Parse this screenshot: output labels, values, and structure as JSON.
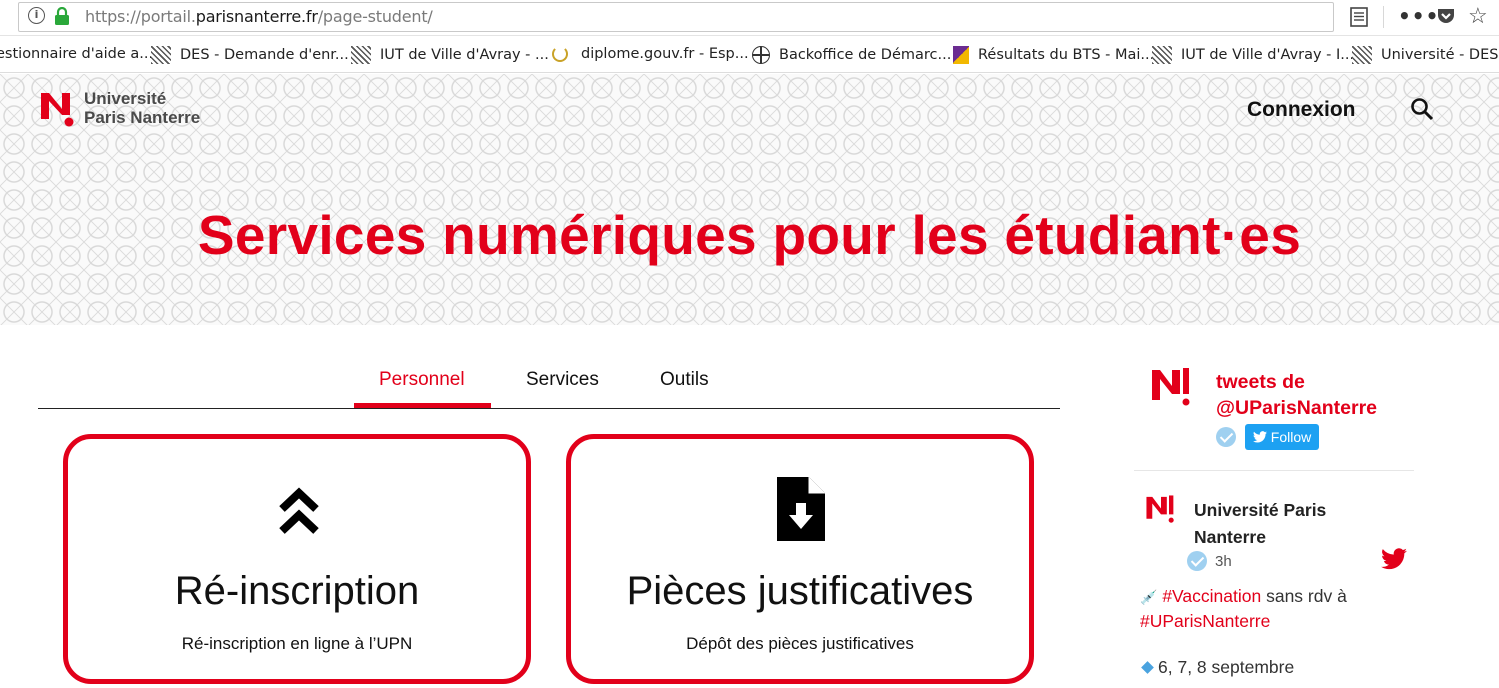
{
  "browser": {
    "url_prefix": "https://portail.",
    "url_domain": "parisnanterre.fr",
    "url_path": "/page-student/",
    "bookmarks": [
      {
        "label": "estionnaire d'aide a...",
        "icon": "none"
      },
      {
        "label": "DES - Demande d'enr...",
        "icon": "hatched-favicon-icon"
      },
      {
        "label": "IUT de Ville d'Avray - ...",
        "icon": "hatched-favicon-icon"
      },
      {
        "label": "diplome.gouv.fr - Esp...",
        "icon": "laurel-favicon-icon"
      },
      {
        "label": "Backoffice de Démarc...",
        "icon": "globe-icon"
      },
      {
        "label": "Résultats du BTS - Mai...",
        "icon": "purple-favicon-icon"
      },
      {
        "label": "IUT de Ville d'Avray - I...",
        "icon": "hatched-favicon-icon"
      },
      {
        "label": "Université - DES - ...",
        "icon": "hatched-favicon-icon"
      }
    ]
  },
  "header": {
    "logo_line1": "Université",
    "logo_line2": "Paris Nanterre",
    "connexion": "Connexion",
    "hero_title": "Services numériques pour les étudiant·es"
  },
  "tabs": [
    {
      "label": "Personnel",
      "active": true
    },
    {
      "label": "Services",
      "active": false
    },
    {
      "label": "Outils",
      "active": false
    }
  ],
  "cards": [
    {
      "title": "Ré-inscription",
      "desc": "Ré-inscription en ligne à l’UPN",
      "icon": "double-chevron-up-icon"
    },
    {
      "title": "Pièces justificatives",
      "desc": "Dépôt des pièces justificatives",
      "icon": "file-download-icon"
    }
  ],
  "twitter": {
    "heading_line1": "tweets de",
    "heading_line2": "@UParisNanterre",
    "follow": "Follow",
    "author_line1": "Université Paris",
    "author_line2": "Nanterre",
    "time": "3h",
    "body_ht1": "#Vaccination",
    "body_text1": " sans rdv à",
    "body_ht2": "#UParisNanterre",
    "body_line2": "6, 7, 8 septembre"
  },
  "colors": {
    "brand_red": "#e2001a",
    "twitter_blue": "#1da1f2"
  }
}
